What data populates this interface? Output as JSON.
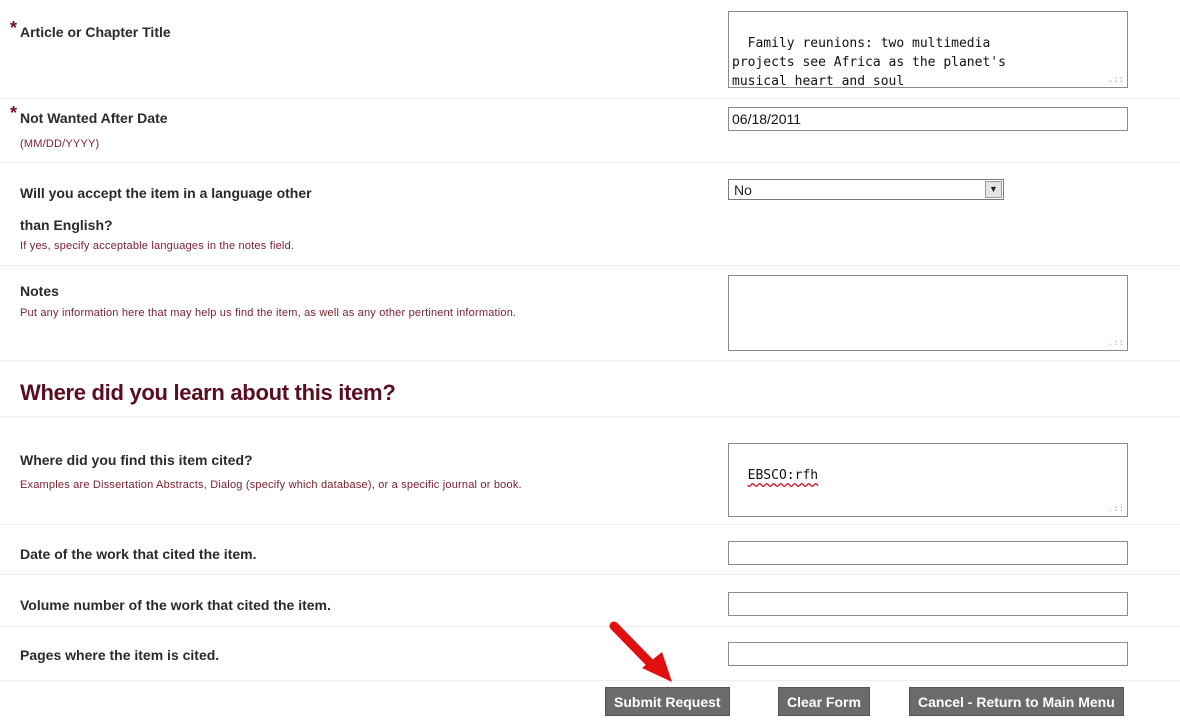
{
  "fields": {
    "article_title": {
      "label": "Article or Chapter Title",
      "required_marker": "*",
      "value": "Family reunions: two multimedia\nprojects see Africa as the planet's\nmusical heart and soul"
    },
    "not_wanted_after": {
      "label": "Not Wanted After Date",
      "required_marker": "*",
      "hint": "(MM/DD/YYYY)",
      "value": "06/18/2011"
    },
    "language": {
      "label_line1": "Will you accept the item in a language other",
      "label_line2": "than English?",
      "hint": "If yes, specify acceptable languages in the notes field.",
      "selected": "No"
    },
    "notes": {
      "label": "Notes",
      "hint": "Put any information here that may help us find the item, as well as any other pertinent information.",
      "value": ""
    }
  },
  "section_heading": "Where did you learn about this item?",
  "citation": {
    "where_cited": {
      "label": "Where did you find this item cited?",
      "hint": "Examples are Dissertation Abstracts, Dialog (specify which database), or a specific journal or book.",
      "value": "EBSCO:rfh"
    },
    "date_cited": {
      "label": "Date of the work that cited the item.",
      "value": ""
    },
    "volume_cited": {
      "label": "Volume number of the work that cited the item.",
      "value": ""
    },
    "pages_cited": {
      "label": "Pages where the item is cited.",
      "value": ""
    }
  },
  "buttons": {
    "submit": "Submit Request",
    "clear": "Clear Form",
    "cancel": "Cancel - Return to Main Menu"
  },
  "colors": {
    "accent": "#5a0d20",
    "button_bg": "#6b6b6b",
    "arrow": "#e01010"
  },
  "icons": {
    "annotation": "red-arrow-icon",
    "dropdown": "chevron-down-icon",
    "resize": "resize-grip-icon"
  }
}
